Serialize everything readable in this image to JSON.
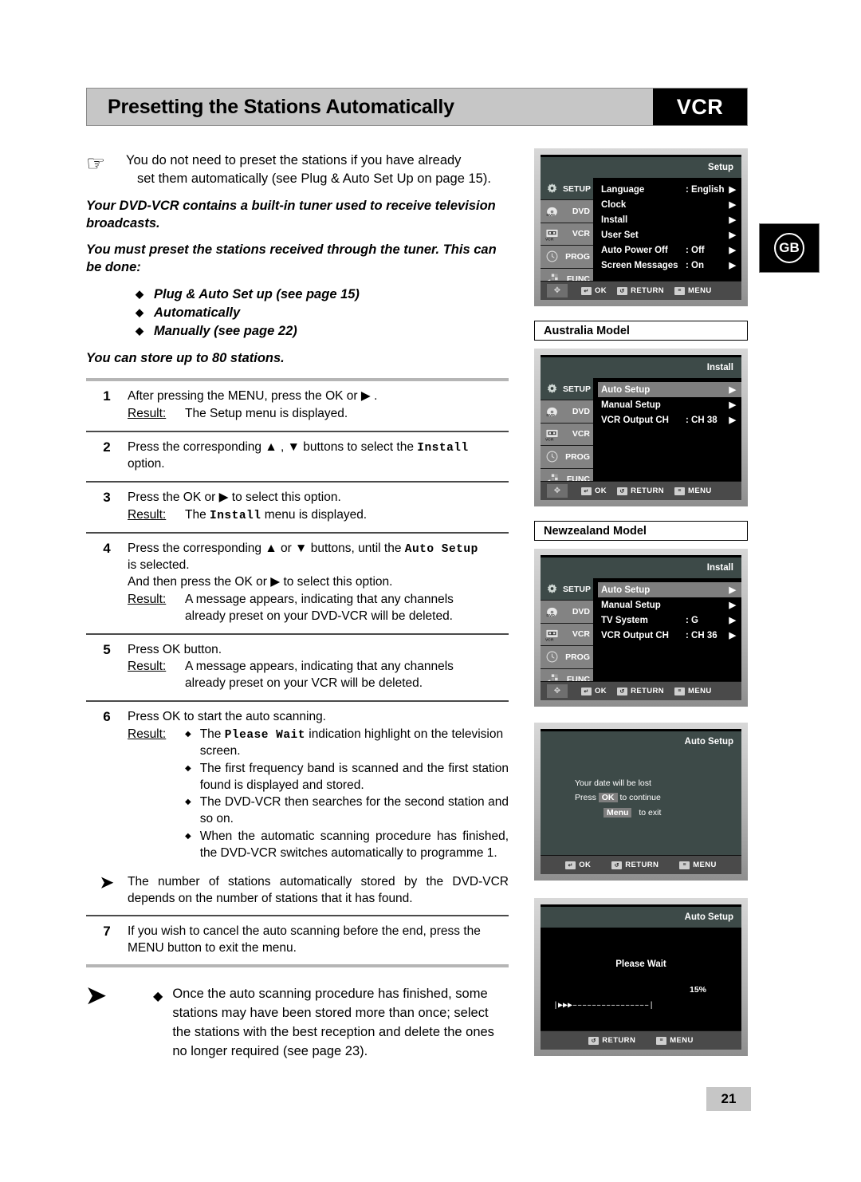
{
  "header": {
    "title": "Presetting the Stations Automatically",
    "badge": "VCR"
  },
  "region_badge": {
    "label": "GB"
  },
  "page_number": "21",
  "intro": {
    "hand_icon": "pointing-hand-icon",
    "note_line1": "You do not need to preset the stations if you have already",
    "note_line2": "set them automatically (see Plug & Auto Set Up on page 15).",
    "para1": "Your DVD-VCR contains a built-in tuner used to receive television broadcasts.",
    "para2": "You must preset the stations received through the tuner. This can be done:",
    "methods": [
      "Plug & Auto Set up (see page 15)",
      "Automatically",
      "Manually  (see page 22)"
    ],
    "para3": "You can store up to 80 stations."
  },
  "steps": [
    {
      "num": "1",
      "lines": [
        "After pressing the MENU, press the OK or ▶ ."
      ],
      "result_label": "Result:",
      "result_lines": [
        "The Setup menu is displayed."
      ]
    },
    {
      "num": "2",
      "lines_rich": {
        "pre": "Press the corresponding ▲ , ▼ buttons to select the ",
        "mono": "Install",
        "post": "option."
      }
    },
    {
      "num": "3",
      "lines": [
        "Press the OK or ▶ to select this option."
      ],
      "result_label": "Result:",
      "result_rich": {
        "pre": "The ",
        "mono": "Install",
        "post": " menu is displayed."
      }
    },
    {
      "num": "4",
      "rich": {
        "pre": "Press the corresponding ▲ or ▼ buttons, until the ",
        "mono": "Auto Setup",
        "post": "is selected."
      },
      "extra_line": "And then press the OK or ▶ to select this option.",
      "result_label": "Result:",
      "result_lines": [
        "A message appears, indicating that any channels",
        "already preset on your DVD-VCR will be deleted."
      ]
    },
    {
      "num": "5",
      "lines": [
        "Press OK button."
      ],
      "result_label": "Result:",
      "result_lines": [
        "A message appears, indicating that any channels",
        "already preset on your VCR will be deleted."
      ]
    },
    {
      "num": "6",
      "lines": [
        "Press OK to start the auto scanning."
      ],
      "result_label": "Result:",
      "bullets": [
        {
          "pre": "The ",
          "mono": "Please Wait",
          "post": " indication highlight on the television screen."
        },
        {
          "plain": "The first frequency band is scanned and the first station found is displayed and stored."
        },
        {
          "plain": "The DVD-VCR then searches for the second station and so on."
        },
        {
          "plain": "When the automatic scanning procedure has finished, the DVD-VCR switches automatically to programme  1."
        }
      ]
    }
  ],
  "note_after_six": "The number of stations automatically stored by the DVD-VCR depends on the number of stations that it has found.",
  "step7": {
    "num": "7",
    "text": "If you wish to cancel the auto scanning before the end, press the MENU button to exit the menu."
  },
  "final_note": {
    "arrow_icon": "arrow-note-icon",
    "bullet": "◆",
    "text": "Once the auto scanning procedure has finished, some stations may have been stored more than once; select the stations with the best reception and delete the ones no longer required (see page 23)."
  },
  "osd_common": {
    "sidebar": [
      {
        "label": "SETUP",
        "icon": "gear-icon"
      },
      {
        "label": "DVD",
        "icon": "disc-icon"
      },
      {
        "label": "VCR",
        "icon": "cassette-icon"
      },
      {
        "label": "PROG",
        "icon": "clock-icon"
      },
      {
        "label": "FUNC",
        "icon": "hand-blocks-icon"
      }
    ],
    "footer": [
      {
        "key": "↵",
        "label": "OK",
        "icon": "ok-key-icon"
      },
      {
        "key": "↺",
        "label": "RETURN",
        "icon": "return-key-icon"
      },
      {
        "key": "≡",
        "label": "MENU",
        "icon": "menu-key-icon"
      }
    ],
    "nav_icon": "dpad-icon",
    "arrow": "▶"
  },
  "screens": {
    "setup": {
      "title": "Setup",
      "rows": [
        {
          "name": "Language",
          "value": ": English",
          "arrow": "▶"
        },
        {
          "name": "Clock",
          "value": "",
          "arrow": "▶"
        },
        {
          "name": "Install",
          "value": "",
          "arrow": "▶"
        },
        {
          "name": "User Set",
          "value": "",
          "arrow": "▶"
        },
        {
          "name": "Auto Power Off",
          "value": ": Off",
          "arrow": "▶"
        },
        {
          "name": "Screen Messages",
          "value": ": On",
          "arrow": "▶"
        }
      ]
    },
    "australia": {
      "caption": "Australia Model",
      "title": "Install",
      "rows": [
        {
          "name": "Auto Setup",
          "value": "",
          "arrow": "▶",
          "highlight": true
        },
        {
          "name": "Manual Setup",
          "value": "",
          "arrow": "▶"
        },
        {
          "name": "VCR Output CH",
          "value": ": CH 38",
          "arrow": "▶"
        }
      ]
    },
    "newzealand": {
      "caption": "Newzealand Model",
      "title": "Install",
      "rows": [
        {
          "name": "Auto Setup",
          "value": "",
          "arrow": "▶",
          "highlight": true
        },
        {
          "name": "Manual Setup",
          "value": "",
          "arrow": "▶"
        },
        {
          "name": "TV System",
          "value": ": G",
          "arrow": "▶"
        },
        {
          "name": "VCR Output CH",
          "value": ": CH 36",
          "arrow": "▶"
        }
      ]
    },
    "confirm": {
      "title": "Auto Setup",
      "line1": "Your date will be lost",
      "line2_pre": "Press",
      "line2_key": "OK",
      "line2_post": "to continue",
      "line3_key": "Menu",
      "line3_post": "to exit"
    },
    "progress": {
      "title": "Auto Setup",
      "wait_text": "Please Wait",
      "percent": "15%",
      "bar": "|▶▶▶––––––––––––––––|",
      "footer": [
        {
          "key": "↺",
          "label": "RETURN",
          "icon": "return-key-icon"
        },
        {
          "key": "≡",
          "label": "MENU",
          "icon": "menu-key-icon"
        }
      ]
    }
  }
}
